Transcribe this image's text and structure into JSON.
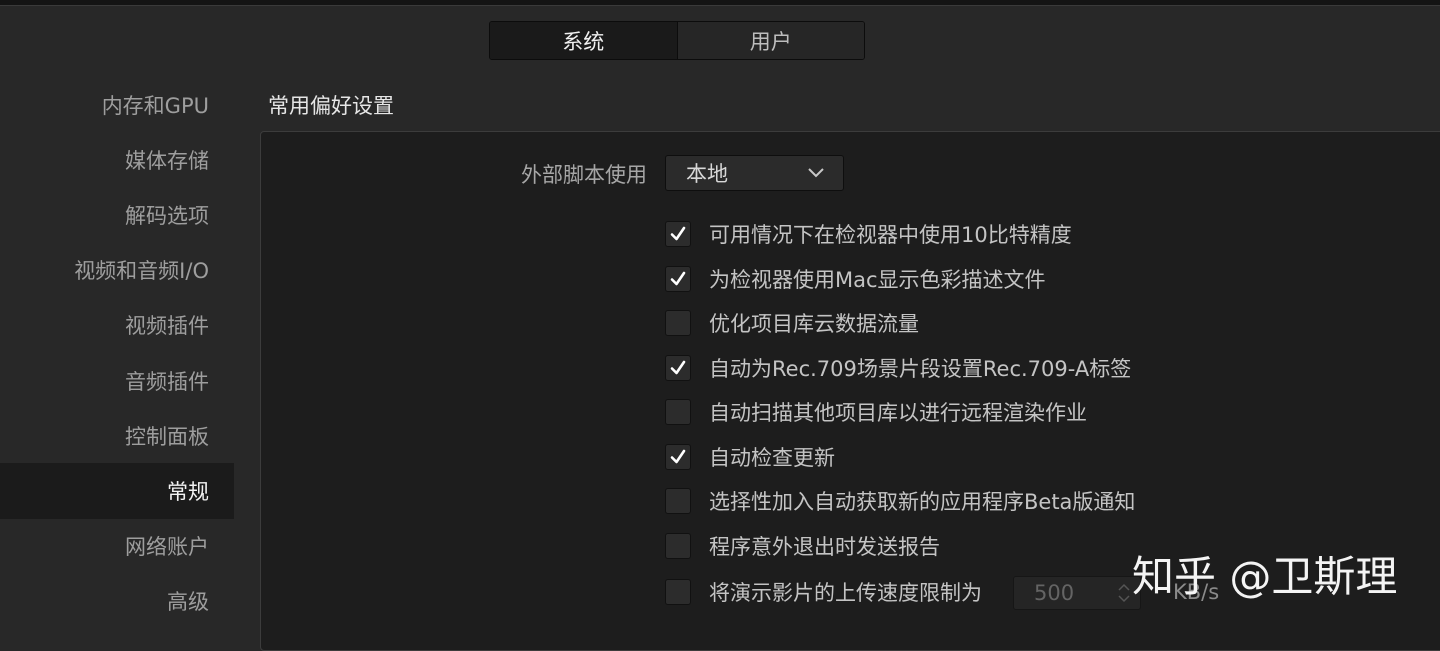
{
  "tabs": [
    {
      "label": "系统",
      "active": true
    },
    {
      "label": "用户",
      "active": false
    }
  ],
  "sidebar": {
    "items": [
      {
        "label": "内存和GPU"
      },
      {
        "label": "媒体存储"
      },
      {
        "label": "解码选项"
      },
      {
        "label": "视频和音频I/O"
      },
      {
        "label": "视频插件"
      },
      {
        "label": "音频插件"
      },
      {
        "label": "控制面板"
      },
      {
        "label": "常规",
        "active": true
      },
      {
        "label": "网络账户"
      },
      {
        "label": "高级"
      }
    ]
  },
  "main": {
    "title": "常用偏好设置",
    "external_script": {
      "label": "外部脚本使用",
      "value": "本地"
    },
    "options": [
      {
        "label": "可用情况下在检视器中使用10比特精度",
        "checked": true
      },
      {
        "label": "为检视器使用Mac显示色彩描述文件",
        "checked": true
      },
      {
        "label": "优化项目库云数据流量",
        "checked": false
      },
      {
        "label": "自动为Rec.709场景片段设置Rec.709-A标签",
        "checked": true
      },
      {
        "label": "自动扫描其他项目库以进行远程渲染作业",
        "checked": false
      },
      {
        "label": "自动检查更新",
        "checked": true
      },
      {
        "label": "选择性加入自动获取新的应用程序Beta版通知",
        "checked": false
      },
      {
        "label": "程序意外退出时发送报告",
        "checked": false
      },
      {
        "label": "将演示影片的上传速度限制为",
        "checked": false
      }
    ],
    "upload_speed": {
      "value": "500",
      "unit": "KB/s"
    }
  },
  "watermark": "知乎 @卫斯理",
  "colors": {
    "background": "#282828",
    "panel": "#1d1d1d",
    "active_item": "#1b1b1b"
  }
}
